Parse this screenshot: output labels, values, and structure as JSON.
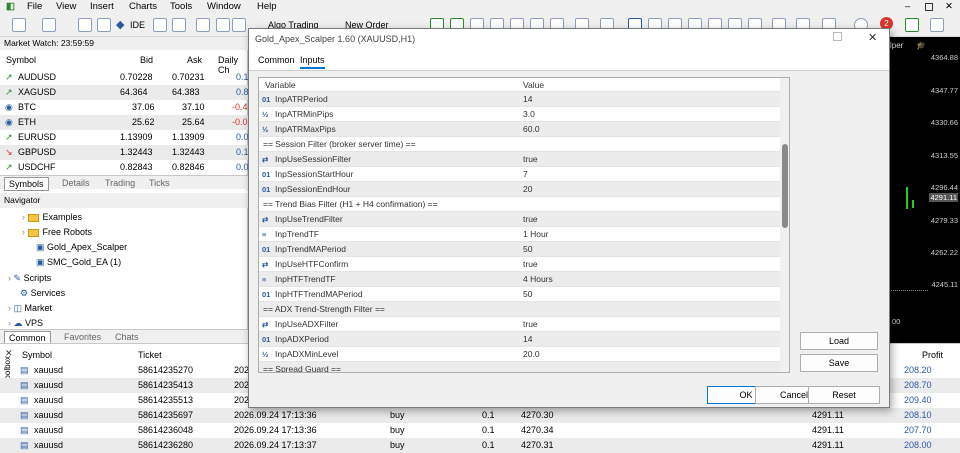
{
  "menu": [
    "File",
    "View",
    "Insert",
    "Charts",
    "Tools",
    "Window",
    "Help"
  ],
  "toolbar": {
    "ide": "IDE",
    "algo": "Algo Trading",
    "new_order": "New Order",
    "badge": "2"
  },
  "market_watch": {
    "title": "Market Watch: 23:59:59",
    "cols": [
      "Symbol",
      "Bid",
      "Ask",
      "Daily Ch"
    ],
    "rows": [
      {
        "s": "AUDUSD",
        "b": "0.70228",
        "a": "0.70231",
        "d": "0.1",
        "dir": "up"
      },
      {
        "s": "XAGUSD",
        "b": "64.364",
        "a": "64.383",
        "d": "0.8",
        "dir": "up"
      },
      {
        "s": "BTC",
        "b": "37.06",
        "a": "37.10",
        "d": "-0.4",
        "dir": "coin"
      },
      {
        "s": "ETH",
        "b": "25.62",
        "a": "25.64",
        "d": "-0.0",
        "dir": "coin"
      },
      {
        "s": "EURUSD",
        "b": "1.13909",
        "a": "1.13909",
        "d": "0.0",
        "dir": "up"
      },
      {
        "s": "GBPUSD",
        "b": "1.32443",
        "a": "1.32443",
        "d": "0.1",
        "dir": "down"
      },
      {
        "s": "USDCHF",
        "b": "0.82843",
        "a": "0.82846",
        "d": "0.0",
        "dir": "up"
      }
    ],
    "tabs": [
      "Symbols",
      "Details",
      "Trading",
      "Ticks"
    ]
  },
  "navigator": {
    "title": "Navigator",
    "items": [
      "Examples",
      "Free Robots",
      "Gold_Apex_Scalper",
      "SMC_Gold_EA (1)",
      "Scripts",
      "Services",
      "Market",
      "VPS"
    ],
    "tabs": [
      "Common",
      "Favorites",
      "Chats"
    ]
  },
  "chart": {
    "label": "lper",
    "prices": [
      "4364.88",
      "4347.77",
      "4330.66",
      "4313.55",
      "4296.44",
      "4291.11",
      "4279.33",
      "4262.22",
      "4245.11"
    ],
    "time": "00"
  },
  "dialog": {
    "title": "Gold_Apex_Scalper 1.60 (XAUUSD,H1)",
    "tabs": [
      "Common",
      "Inputs"
    ],
    "col_var": "Variable",
    "col_val": "Value",
    "params": [
      {
        "i": "01",
        "n": "InpATRPeriod",
        "v": "14"
      },
      {
        "i": "½",
        "n": "InpATRMinPips",
        "v": "3.0"
      },
      {
        "i": "½",
        "n": "InpATRMaxPips",
        "v": "60.0"
      },
      {
        "i": "sec",
        "n": "== Session Filter (broker server time) ==",
        "v": ""
      },
      {
        "i": "⇄",
        "n": "InpUseSessionFilter",
        "v": "true"
      },
      {
        "i": "01",
        "n": "InpSessionStartHour",
        "v": "7"
      },
      {
        "i": "01",
        "n": "InpSessionEndHour",
        "v": "20"
      },
      {
        "i": "sec",
        "n": "== Trend Bias Filter (H1 + H4 confirmation) ==",
        "v": ""
      },
      {
        "i": "⇄",
        "n": "InpUseTrendFilter",
        "v": "true"
      },
      {
        "i": "≡",
        "n": "InpTrendTF",
        "v": "1 Hour"
      },
      {
        "i": "01",
        "n": "InpTrendMAPeriod",
        "v": "50"
      },
      {
        "i": "⇄",
        "n": "InpUseHTFConfirm",
        "v": "true"
      },
      {
        "i": "≡",
        "n": "InpHTFTrendTF",
        "v": "4 Hours"
      },
      {
        "i": "01",
        "n": "InpHTFTrendMAPeriod",
        "v": "50"
      },
      {
        "i": "sec",
        "n": "== ADX Trend-Strength Filter ==",
        "v": ""
      },
      {
        "i": "⇄",
        "n": "InpUseADXFilter",
        "v": "true"
      },
      {
        "i": "01",
        "n": "InpADXPeriod",
        "v": "14"
      },
      {
        "i": "½",
        "n": "InpADXMinLevel",
        "v": "20.0"
      },
      {
        "i": "sec",
        "n": "== Spread Guard ==",
        "v": ""
      }
    ],
    "load": "Load",
    "save": "Save",
    "ok": "OK",
    "cancel": "Cancel",
    "reset": "Reset"
  },
  "trades": {
    "tabs": [
      "Toolbox"
    ],
    "cols": [
      "Symbol",
      "Ticket",
      "",
      "",
      "",
      "",
      "Profit"
    ],
    "rows": [
      {
        "s": "xauusd",
        "t": "58614235270",
        "tm": "202",
        "ty": "",
        "v": "",
        "p": "",
        "c": "",
        "pr": "208.20"
      },
      {
        "s": "xauusd",
        "t": "58614235413",
        "tm": "202",
        "ty": "",
        "v": "",
        "p": "",
        "c": "",
        "pr": "208.70"
      },
      {
        "s": "xauusd",
        "t": "58614235513",
        "tm": "202",
        "ty": "",
        "v": "",
        "p": "",
        "c": "",
        "pr": "209.40"
      },
      {
        "s": "xauusd",
        "t": "58614235697",
        "tm": "2026.09.24 17:13:36",
        "ty": "buy",
        "v": "0.1",
        "p": "4270.30",
        "c": "4291.11",
        "pr": "208.10"
      },
      {
        "s": "xauusd",
        "t": "58614236048",
        "tm": "2026.09.24 17:13:36",
        "ty": "buy",
        "v": "0.1",
        "p": "4270.34",
        "c": "4291.11",
        "pr": "207.70"
      },
      {
        "s": "xauusd",
        "t": "58614236280",
        "tm": "2026.09.24 17:13:37",
        "ty": "buy",
        "v": "0.1",
        "p": "4270.31",
        "c": "4291.11",
        "pr": "208.00"
      }
    ]
  }
}
